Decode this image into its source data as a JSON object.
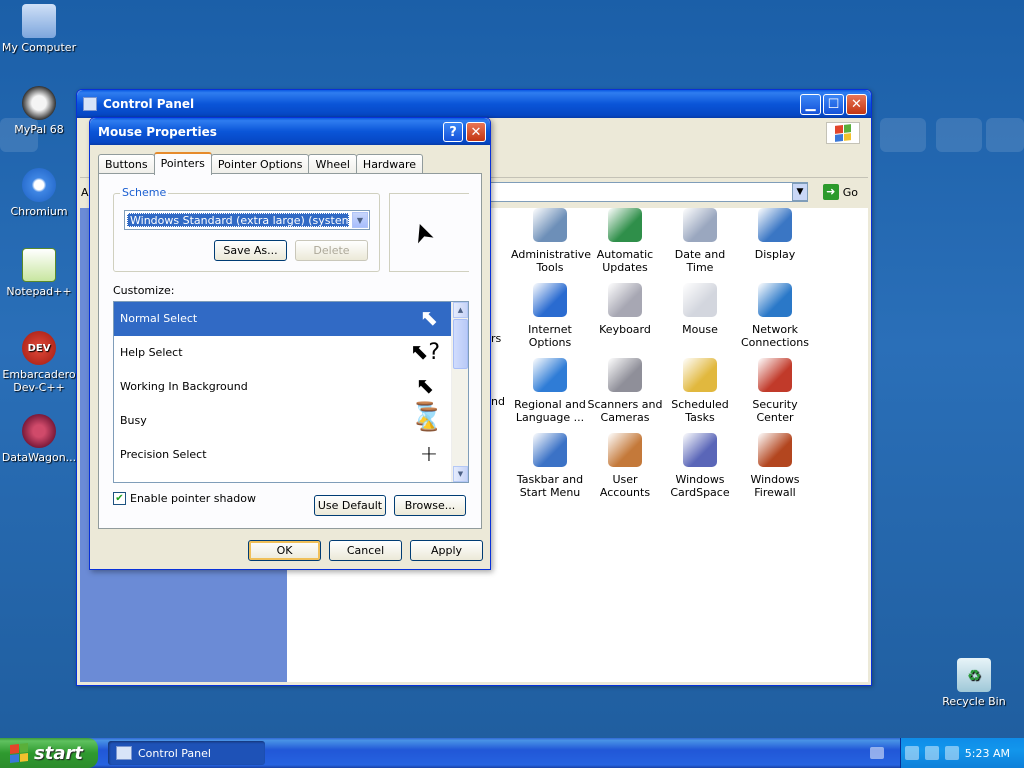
{
  "desktop": {
    "icons": [
      {
        "label": "My Computer"
      },
      {
        "label": "MyPal 68"
      },
      {
        "label": "Chromium"
      },
      {
        "label": "Notepad++"
      },
      {
        "label": "Embarcadero Dev-C++",
        "badge": "DEV"
      },
      {
        "label": "DataWagon..."
      },
      {
        "label": "Recycle Bin"
      }
    ]
  },
  "control_panel": {
    "title": "Control Panel",
    "go_label": "Go",
    "items": [
      {
        "label": "Administrative Tools",
        "color": "#6d8fb8"
      },
      {
        "label": "Automatic Updates",
        "color": "#2f8f4a"
      },
      {
        "label": "Date and Time",
        "color": "#9aa7bf"
      },
      {
        "label": "Display",
        "color": "#3a76c4"
      },
      {
        "label": "Internet Options",
        "color": "#2a6bd0"
      },
      {
        "label": "Keyboard",
        "color": "#a7a7b3"
      },
      {
        "label": "Mouse",
        "color": "#d3d6de"
      },
      {
        "label": "Network Connections",
        "color": "#2a78c8"
      },
      {
        "label": "Regional and Language ...",
        "color": "#2f7cd6"
      },
      {
        "label": "Scanners and Cameras",
        "color": "#8f8f99"
      },
      {
        "label": "Scheduled Tasks",
        "color": "#e1b83e"
      },
      {
        "label": "Security Center",
        "color": "#c13a2a"
      },
      {
        "label": "Taskbar and Start Menu",
        "color": "#3b72c6"
      },
      {
        "label": "User Accounts",
        "color": "#c4793a"
      },
      {
        "label": "Windows CardSpace",
        "color": "#5a66b8"
      },
      {
        "label": "Windows Firewall",
        "color": "#b3461f"
      }
    ],
    "partial_labels": [
      "A",
      "...",
      "rs",
      "nd"
    ]
  },
  "dialog": {
    "title": "Mouse Properties",
    "tabs": [
      "Buttons",
      "Pointers",
      "Pointer Options",
      "Wheel",
      "Hardware"
    ],
    "active_tab": "Pointers",
    "scheme_label": "Scheme",
    "scheme_value": "Windows Standard (extra large) (system scheme)",
    "save_as_label": "Save As...",
    "delete_label": "Delete",
    "customize_label": "Customize:",
    "pointers": [
      {
        "name": "Normal Select",
        "glyph": "➤",
        "selected": true
      },
      {
        "name": "Help Select",
        "glyph": "➤?",
        "selected": false
      },
      {
        "name": "Working In Background",
        "glyph": "➤⌛",
        "selected": false
      },
      {
        "name": "Busy",
        "glyph": "⌛",
        "selected": false
      },
      {
        "name": "Precision Select",
        "glyph": "+",
        "selected": false
      }
    ],
    "shadow_label": "Enable pointer shadow",
    "shadow_checked": true,
    "use_default_label": "Use Default",
    "browse_label": "Browse...",
    "ok_label": "OK",
    "cancel_label": "Cancel",
    "apply_label": "Apply",
    "help_button": "?",
    "close_button": "✕"
  },
  "taskbar": {
    "start_label": "start",
    "task_label": "Control Panel",
    "clock": "5:23 AM"
  }
}
